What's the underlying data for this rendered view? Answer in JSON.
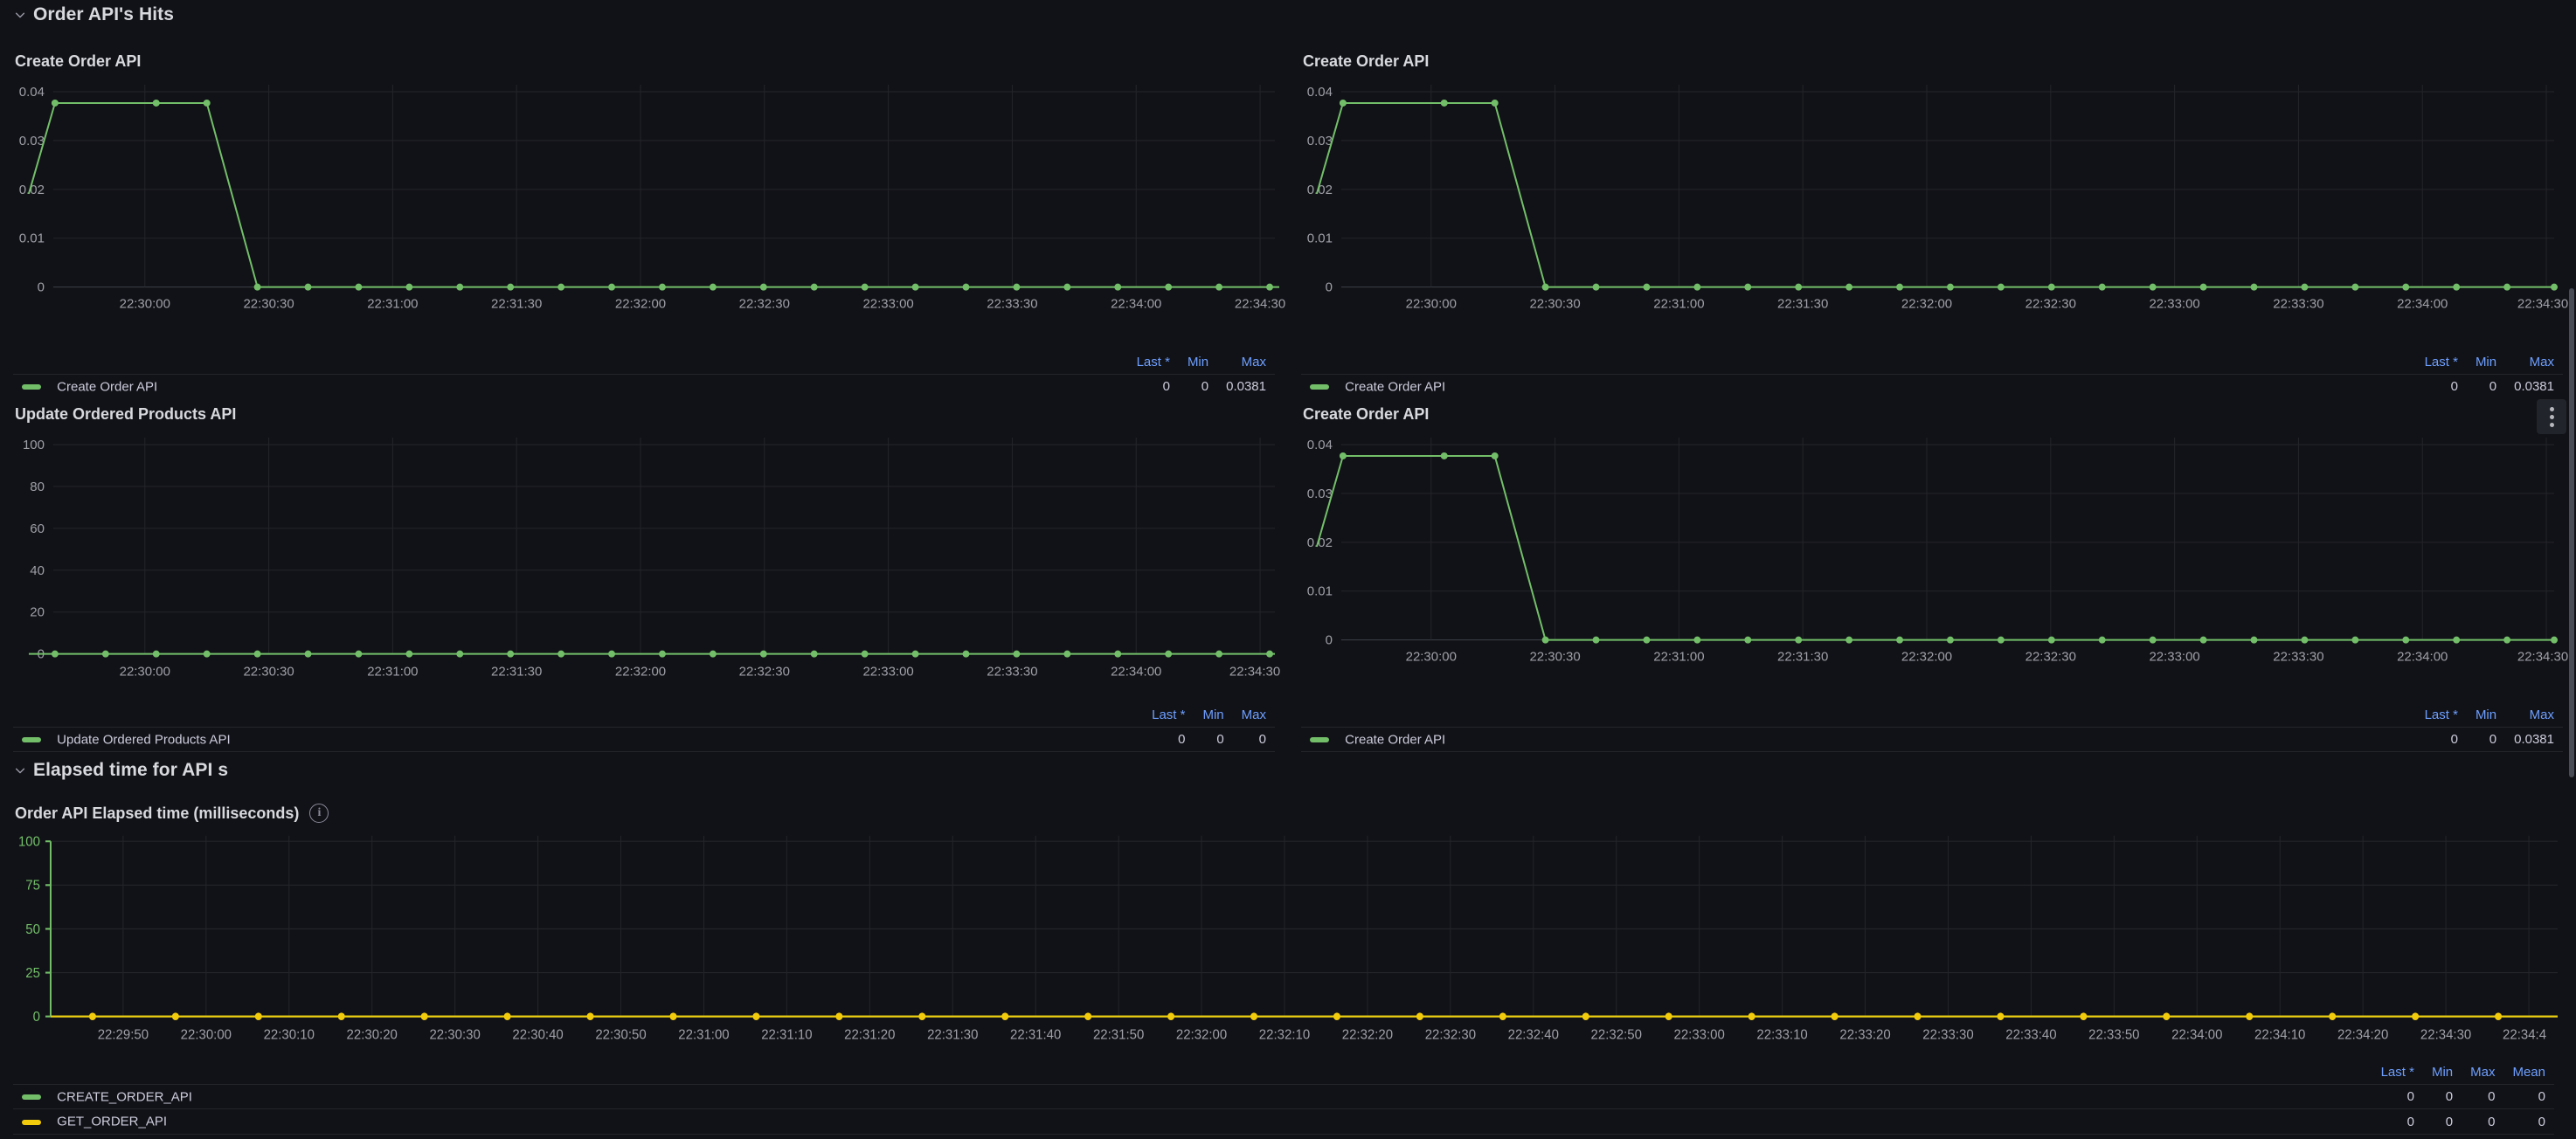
{
  "rows": [
    {
      "id": "order-api-hits",
      "title": "Order API's Hits",
      "caret": "chevron-down-icon",
      "expanded": true
    },
    {
      "id": "elapsed-time",
      "title": "Elapsed time for API s",
      "caret": "chevron-down-icon",
      "expanded": true
    }
  ],
  "colors": {
    "green": "#73bf69",
    "yellow": "#f2cc0c",
    "legend_header": "#6e9fff",
    "background": "#111217",
    "grid": "#23252b",
    "text": "#ccccdc"
  },
  "panels": [
    {
      "id": "create-order-api-1",
      "title": "Create Order API",
      "has_menu": false,
      "has_info": false,
      "legend_headers": [
        "Last *",
        "Min",
        "Max"
      ],
      "series": [
        {
          "name": "Create Order API",
          "color": "#73bf69",
          "stats": [
            "0",
            "0",
            "0.0381"
          ]
        }
      ]
    },
    {
      "id": "create-order-api-2",
      "title": "Create Order API",
      "has_menu": false,
      "has_info": false,
      "legend_headers": [
        "Last *",
        "Min",
        "Max"
      ],
      "series": [
        {
          "name": "Create Order API",
          "color": "#73bf69",
          "stats": [
            "0",
            "0",
            "0.0381"
          ]
        }
      ]
    },
    {
      "id": "update-ordered-products-api",
      "title": "Update Ordered Products API",
      "has_menu": false,
      "has_info": false,
      "legend_headers": [
        "Last *",
        "Min",
        "Max"
      ],
      "series": [
        {
          "name": "Update Ordered Products API",
          "color": "#73bf69",
          "stats": [
            "0",
            "0",
            "0"
          ]
        }
      ]
    },
    {
      "id": "create-order-api-3",
      "title": "Create Order API",
      "has_menu": true,
      "has_info": false,
      "legend_headers": [
        "Last *",
        "Min",
        "Max"
      ],
      "series": [
        {
          "name": "Create Order API",
          "color": "#73bf69",
          "stats": [
            "0",
            "0",
            "0.0381"
          ]
        }
      ]
    },
    {
      "id": "order-api-elapsed-time",
      "title": "Order API Elapsed time (milliseconds)",
      "has_menu": false,
      "has_info": true,
      "legend_headers": [
        "Last *",
        "Min",
        "Max",
        "Mean"
      ],
      "series": [
        {
          "name": "CREATE_ORDER_API",
          "color": "#73bf69",
          "stats": [
            "0",
            "0",
            "0",
            "0"
          ]
        },
        {
          "name": "GET_ORDER_API",
          "color": "#f2cc0c",
          "stats": [
            "0",
            "0",
            "0",
            "0"
          ]
        }
      ]
    }
  ],
  "chart_data": [
    {
      "id": "create-order-api-1",
      "type": "line",
      "title": "Create Order API",
      "xlabel": "",
      "ylabel": "",
      "ylim": [
        0,
        0.042
      ],
      "yticks": [
        "0",
        "0.01",
        "0.02",
        "0.03",
        "0.04"
      ],
      "ytick_values": [
        0,
        0.01,
        0.02,
        0.03,
        0.04
      ],
      "xticks": [
        "22:30:00",
        "22:30:30",
        "22:31:00",
        "22:31:30",
        "22:32:00",
        "22:32:30",
        "22:33:00",
        "22:33:30",
        "22:34:00",
        "22:34:30"
      ],
      "grid": true,
      "legend_position": "bottom",
      "series": [
        {
          "name": "Create Order API",
          "color": "#73bf69",
          "x": [
            0.5,
            3.3,
            6.2,
            9.2,
            12.1,
            15.0,
            18.0,
            21.0,
            24.0,
            27.0,
            30.0,
            33.0,
            36.0,
            39.0,
            42.0,
            45.0,
            48.0,
            51.0,
            54.0,
            57.0,
            60.0,
            63.0,
            66.0,
            69.0,
            72.0,
            75.0,
            78.0,
            81.0,
            84.0,
            87.0,
            90.0,
            93.0,
            96.0,
            100.0
          ],
          "y": [
            0.0196,
            0.0381,
            0.0381,
            0.0381,
            0.0381,
            0,
            0,
            0,
            0,
            0,
            0,
            0,
            0,
            0,
            0,
            0,
            0,
            0,
            0,
            0,
            0,
            0,
            0,
            0,
            0,
            0,
            0,
            0,
            0,
            0,
            0,
            0,
            0,
            0
          ]
        }
      ]
    },
    {
      "id": "create-order-api-2",
      "type": "line",
      "title": "Create Order API",
      "ylim": [
        0,
        0.042
      ],
      "yticks": [
        "0",
        "0.01",
        "0.02",
        "0.03",
        "0.04"
      ],
      "ytick_values": [
        0,
        0.01,
        0.02,
        0.03,
        0.04
      ],
      "xticks": [
        "22:30:00",
        "22:30:30",
        "22:31:00",
        "22:31:30",
        "22:32:00",
        "22:32:30",
        "22:33:00",
        "22:33:30",
        "22:34:00",
        "22:34:30"
      ],
      "grid": true,
      "series": [
        {
          "name": "Create Order API",
          "color": "#73bf69",
          "y_pattern": "same as create-order-api-1",
          "max": 0.0381
        }
      ]
    },
    {
      "id": "update-ordered-products-api",
      "type": "line",
      "title": "Update Ordered Products API",
      "ylim": [
        0,
        105
      ],
      "yticks": [
        "0",
        "20",
        "40",
        "60",
        "80",
        "100"
      ],
      "ytick_values": [
        0,
        20,
        40,
        60,
        80,
        100
      ],
      "xticks": [
        "22:30:00",
        "22:30:30",
        "22:31:00",
        "22:31:30",
        "22:32:00",
        "22:32:30",
        "22:33:00",
        "22:33:30",
        "22:34:00",
        "22:34:30"
      ],
      "grid": true,
      "series": [
        {
          "name": "Update Ordered Products API",
          "color": "#73bf69",
          "constant_value": 0
        }
      ]
    },
    {
      "id": "create-order-api-3",
      "type": "line",
      "title": "Create Order API",
      "ylim": [
        0,
        0.042
      ],
      "yticks": [
        "0",
        "0.01",
        "0.02",
        "0.03",
        "0.04"
      ],
      "ytick_values": [
        0,
        0.01,
        0.02,
        0.03,
        0.04
      ],
      "xticks": [
        "22:30:00",
        "22:30:30",
        "22:31:00",
        "22:31:30",
        "22:32:00",
        "22:32:30",
        "22:33:00",
        "22:33:30",
        "22:34:00",
        "22:34:30"
      ],
      "grid": true,
      "series": [
        {
          "name": "Create Order API",
          "color": "#73bf69",
          "y_pattern": "same as create-order-api-1",
          "max": 0.0381
        }
      ]
    },
    {
      "id": "order-api-elapsed-time",
      "type": "line",
      "title": "Order API Elapsed time (milliseconds)",
      "ylim": [
        0,
        100
      ],
      "yticks": [
        "0",
        "25",
        "50",
        "75",
        "100"
      ],
      "ytick_values": [
        0,
        25,
        50,
        75,
        100
      ],
      "yaxis_color": "#73bf69",
      "xticks": [
        "22:29:50",
        "22:30:00",
        "22:30:10",
        "22:30:20",
        "22:30:30",
        "22:30:40",
        "22:30:50",
        "22:31:00",
        "22:31:10",
        "22:31:20",
        "22:31:30",
        "22:31:40",
        "22:31:50",
        "22:32:00",
        "22:32:10",
        "22:32:20",
        "22:32:30",
        "22:32:40",
        "22:32:50",
        "22:33:00",
        "22:33:10",
        "22:33:20",
        "22:33:30",
        "22:33:40",
        "22:33:50",
        "22:34:00",
        "22:34:10",
        "22:34:20",
        "22:34:30",
        "22:34:4"
      ],
      "grid": true,
      "series": [
        {
          "name": "CREATE_ORDER_API",
          "color": "#73bf69",
          "constant_value": 0
        },
        {
          "name": "GET_ORDER_API",
          "color": "#f2cc0c",
          "constant_value": 0
        }
      ]
    }
  ]
}
